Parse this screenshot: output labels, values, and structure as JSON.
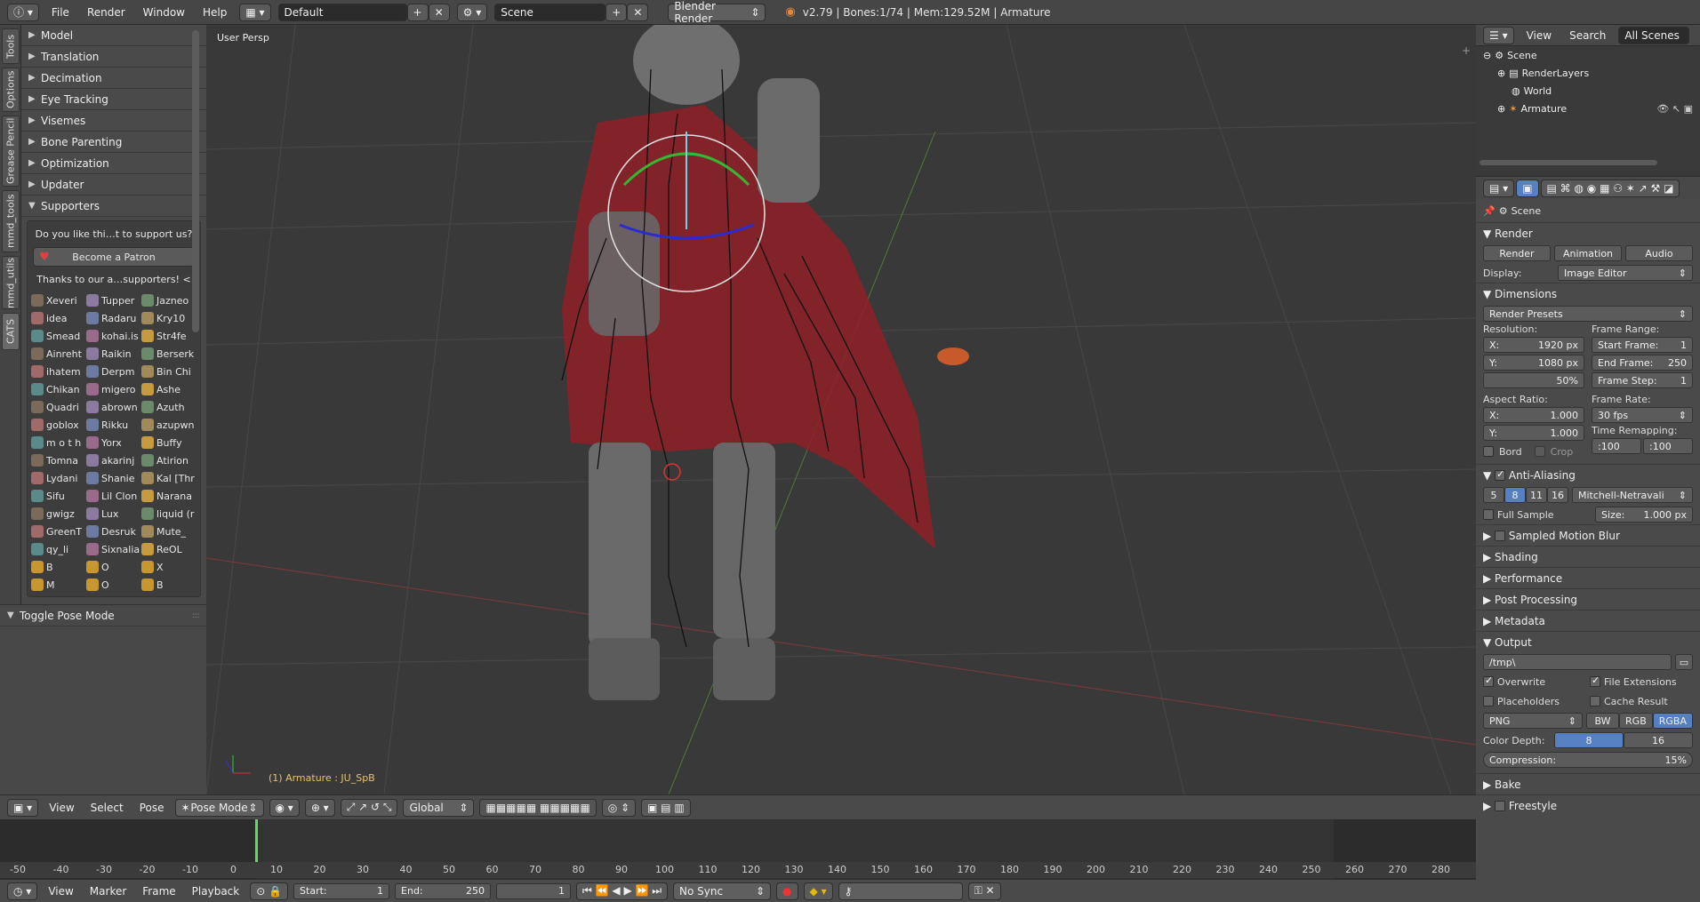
{
  "topbar": {
    "menus": [
      "File",
      "Render",
      "Window",
      "Help"
    ],
    "layout": "Default",
    "scene": "Scene",
    "engine": "Blender Render",
    "stats": "v2.79 | Bones:1/74 | Mem:129.52M | Armature"
  },
  "tabs": [
    "Tools",
    "Options",
    "Grease Pencil",
    "mmd_tools",
    "mmd_utils",
    "CATS"
  ],
  "shelf": {
    "panels": [
      "Model",
      "Translation",
      "Decimation",
      "Eye Tracking",
      "Visemes",
      "Bone Parenting",
      "Optimization",
      "Updater"
    ],
    "supporters_title": "Supporters",
    "question": "Do you like thi…t to support us?",
    "patron_label": "Become a Patron",
    "thanks": "Thanks to our a…supporters! <",
    "names": [
      "Xeveri",
      "Tupper",
      "Jazneo",
      "idea",
      "Radaru",
      "Kry10",
      "Smead",
      "kohai.is",
      "Str4fe",
      "Ainreht",
      "Raikin",
      "Berserk",
      "ihatem",
      "Derpm",
      "Bin Chi",
      "Chikan",
      "migero",
      "Ashe",
      "Quadri",
      "abrown",
      "Azuth",
      "goblox",
      "Rikku",
      "azupwn",
      "m o t h",
      "Yorx",
      "Buffy",
      "Tomna",
      "akarinj",
      "Atirion",
      "Lydani",
      "Shanie",
      "Kal [Thr",
      "Sifu",
      "Lil Clon",
      "Narana",
      "gwigz",
      "Lux",
      "liquid (r",
      "GreenT",
      "Desruk",
      "Mute_",
      "qy_li",
      "Sixnalia",
      "ReOL",
      "B",
      "O",
      "X",
      "M",
      "O",
      "B"
    ],
    "toggle_pose": "Toggle Pose Mode"
  },
  "viewport": {
    "label": "User Persp",
    "selection": "(1) Armature : JU_SpB"
  },
  "vp_header": {
    "menus": [
      "View",
      "Select",
      "Pose"
    ],
    "mode": "Pose Mode",
    "orientation": "Global"
  },
  "timeline": {
    "ticks": [
      "-50",
      "-40",
      "-30",
      "-20",
      "-10",
      "0",
      "10",
      "20",
      "30",
      "40",
      "50",
      "60",
      "70",
      "80",
      "90",
      "100",
      "110",
      "120",
      "130",
      "140",
      "150",
      "160",
      "170",
      "180",
      "190",
      "200",
      "210",
      "220",
      "230",
      "240",
      "250",
      "260",
      "270",
      "280"
    ],
    "menus": [
      "View",
      "Marker",
      "Frame",
      "Playback"
    ],
    "start": "Start:",
    "start_val": "1",
    "end": "End:",
    "end_val": "250",
    "current": "1",
    "sync": "No Sync"
  },
  "outliner": {
    "menus": [
      "View",
      "Search"
    ],
    "filter": "All Scenes",
    "items": [
      "Scene",
      "RenderLayers",
      "World",
      "Armature"
    ]
  },
  "props": {
    "context": "Scene",
    "render": {
      "title": "Render",
      "buttons": [
        "Render",
        "Animation",
        "Audio"
      ],
      "display_label": "Display:",
      "display": "Image Editor"
    },
    "dimensions": {
      "title": "Dimensions",
      "presets": "Render Presets",
      "res_label": "Resolution:",
      "res_x": "X:",
      "res_x_val": "1920 px",
      "res_y": "Y:",
      "res_y_val": "1080 px",
      "pct": "50%",
      "frame_range": "Frame Range:",
      "start": "Start Frame:",
      "start_val": "1",
      "end": "End Frame:",
      "end_val": "250",
      "step": "Frame Step:",
      "step_val": "1",
      "aspect": "Aspect Ratio:",
      "ax": "X:",
      "ax_val": "1.000",
      "ay": "Y:",
      "ay_val": "1.000",
      "frame_rate": "Frame Rate:",
      "fps": "30 fps",
      "remap": "Time Remapping:",
      "remap_a": ":100",
      "remap_b": ":100",
      "bord": "Bord",
      "crop": "Crop"
    },
    "aa": {
      "title": "Anti-Aliasing",
      "levels": [
        "5",
        "8",
        "11",
        "16"
      ],
      "filter": "Mitchell-Netravali",
      "full": "Full Sample",
      "size": "Size:",
      "size_val": "1.000 px"
    },
    "sections": [
      "Sampled Motion Blur",
      "Shading",
      "Performance",
      "Post Processing",
      "Metadata"
    ],
    "output": {
      "title": "Output",
      "path": "/tmp\\",
      "overwrite": "Overwrite",
      "file_ext": "File Extensions",
      "placeholders": "Placeholders",
      "cache": "Cache Result",
      "format": "PNG",
      "modes": [
        "BW",
        "RGB",
        "RGBA"
      ],
      "depth_label": "Color Depth:",
      "depth_8": "8",
      "depth_16": "16",
      "compression": "Compression:",
      "compression_val": "15%"
    },
    "bake": "Bake",
    "freestyle": "Freestyle"
  }
}
